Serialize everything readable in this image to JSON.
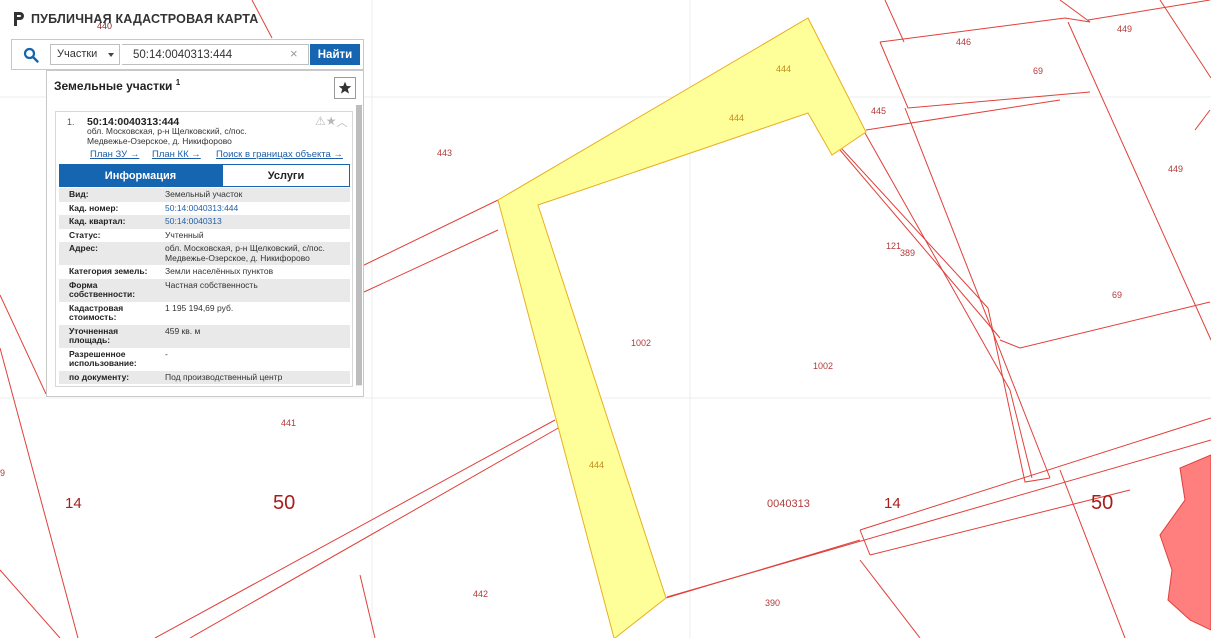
{
  "app": {
    "title": "ПУБЛИЧНАЯ КАДАСТРОВАЯ КАРТА"
  },
  "search": {
    "type_label": "Участки",
    "query": "50:14:0040313:444",
    "clear_glyph": "×",
    "find_label": "Найти"
  },
  "panel": {
    "title": "Земельные участки",
    "count": "1"
  },
  "result": {
    "number": "1.",
    "cadnum": "50:14:0040313:444",
    "address_line1": "обл. Московская, р-н Щелковский, с/пос.",
    "address_line2": "Медвежье-Озерское, д. Никифорово",
    "links": [
      "План ЗУ →",
      "План КК →",
      "Поиск в границах объекта →"
    ],
    "tabs": [
      "Информация",
      "Услуги"
    ],
    "info": [
      {
        "key": "Вид:",
        "value": "Земельный участок"
      },
      {
        "key": "Кад. номер:",
        "value": "50:14:0040313:444"
      },
      {
        "key": "Кад. квартал:",
        "value": "50:14:0040313"
      },
      {
        "key": "Статус:",
        "value": "Учтенный"
      },
      {
        "key": "Адрес:",
        "value": "обл. Московская, р-н Щелковский, с/пос. Медвежье-Озерское, д. Никифорово"
      },
      {
        "key": "Категория земель:",
        "value": "Земли населённых пунктов"
      },
      {
        "key": "Форма собственности:",
        "value": "Частная собственность"
      },
      {
        "key": "Кадастровая стоимость:",
        "value": "1 195 194,69 руб."
      },
      {
        "key": "Уточненная площадь:",
        "value": "459 кв. м"
      },
      {
        "key": "Разрешенное использование:",
        "value": "-"
      },
      {
        "key": "по документу:",
        "value": "Под производственный центр"
      }
    ]
  },
  "map_labels": {
    "l440": "440",
    "l446": "446",
    "l449a": "449",
    "l69a": "69",
    "l444a": "444",
    "l444b": "444",
    "l445": "445",
    "l443": "443",
    "l449b": "449",
    "l121": "121",
    "l389": "389",
    "l69b": "69",
    "l1002a": "1002",
    "l1002b": "1002",
    "l441": "441",
    "l444c": "444",
    "l14a": "14",
    "l50a": "50",
    "l0040313": "0040313",
    "l14b": "14",
    "l50b": "50",
    "l442": "442",
    "l390": "390",
    "l9": "9"
  },
  "colors": {
    "parcel_line": "#e0403a",
    "selected_fill": "#ffff99",
    "selected_line": "#e8b020",
    "building": "#ff7f7f",
    "primary": "#1565b0"
  }
}
